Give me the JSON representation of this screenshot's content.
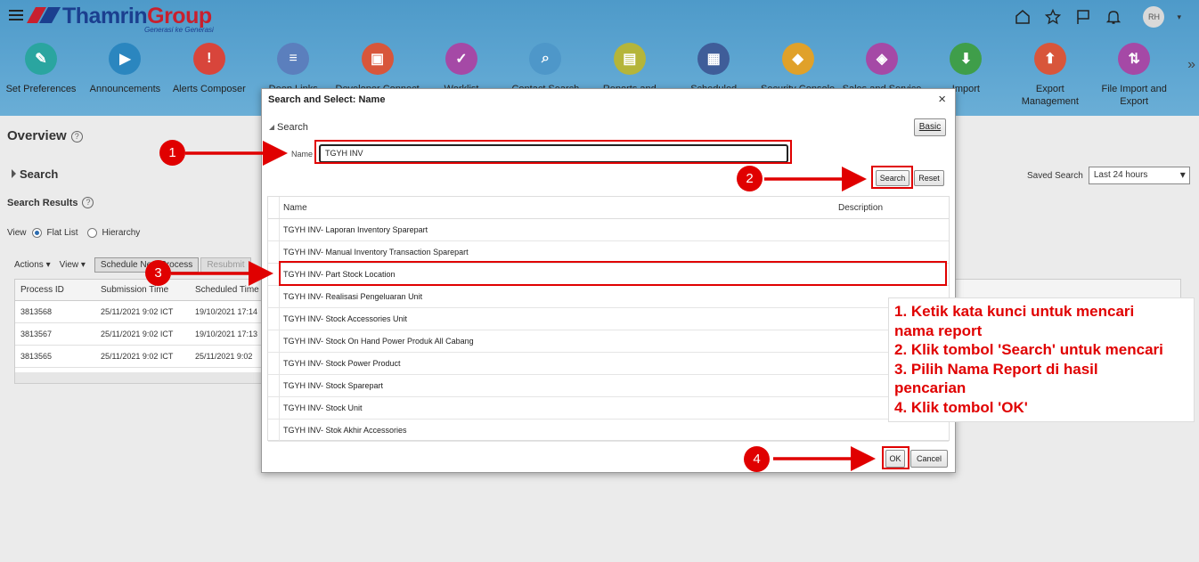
{
  "brand": {
    "name_main": "Thamrin",
    "name_group": "Group",
    "tagline": "Generasi ke Generasi"
  },
  "user": {
    "initials": "RH"
  },
  "springboard": [
    {
      "label": "Set Preferences",
      "icon": "preferences-icon",
      "color": "#2aa5a0"
    },
    {
      "label": "Announcements",
      "icon": "megaphone-icon",
      "color": "#2b86bf"
    },
    {
      "label": "Alerts Composer",
      "icon": "alert-icon",
      "color": "#d8453b"
    },
    {
      "label": "Deep Links",
      "icon": "users-link-icon",
      "color": "#5b7fbd"
    },
    {
      "label": "Developer Connect",
      "icon": "developer-icon",
      "color": "#d8563b"
    },
    {
      "label": "Worklist",
      "icon": "worklist-icon",
      "color": "#a549a6"
    },
    {
      "label": "Contact Search",
      "icon": "contact-search-icon",
      "color": "#4e97c9"
    },
    {
      "label": "Reports and",
      "icon": "reports-icon",
      "color": "#b5b53a"
    },
    {
      "label": "Scheduled",
      "icon": "calendar-icon",
      "color": "#3f5d99"
    },
    {
      "label": "Security Console",
      "icon": "security-icon",
      "color": "#e0a12a"
    },
    {
      "label": "Sales and Service",
      "icon": "shield-icon",
      "color": "#a549a6"
    },
    {
      "label": "Import",
      "icon": "import-icon",
      "color": "#3f9e4a"
    },
    {
      "label": "Export Management",
      "icon": "export-icon",
      "color": "#d8563b"
    },
    {
      "label": "File Import and Export",
      "icon": "file-transfer-icon",
      "color": "#a549a6"
    }
  ],
  "background": {
    "overview": "Overview",
    "search": "Search",
    "search_results": "Search Results",
    "view_label": "View",
    "flat_list": "Flat List",
    "hierarchy": "Hierarchy",
    "actions": "Actions",
    "view_menu": "View",
    "schedule_btn": "Schedule New Process",
    "resubmit_btn": "Resubmit",
    "saved_search_label": "Saved Search",
    "saved_search_value": "Last 24 hours",
    "columns": [
      "Process ID",
      "Submission Time",
      "Scheduled Time"
    ],
    "rows": [
      [
        "3813568",
        "25/11/2021 9:02 ICT",
        "19/10/2021 17:14"
      ],
      [
        "3813567",
        "25/11/2021 9:02 ICT",
        "19/10/2021 17:13"
      ],
      [
        "3813565",
        "25/11/2021 9:02 ICT",
        "25/11/2021 9:02"
      ]
    ]
  },
  "dialog": {
    "title": "Search and Select: Name",
    "search_header": "Search",
    "basic": "Basic",
    "name_label": "Name",
    "name_value": "TGYH INV",
    "search_btn": "Search",
    "reset_btn": "Reset",
    "col_name": "Name",
    "col_desc": "Description",
    "results": [
      "TGYH INV- Laporan Inventory Sparepart",
      "TGYH INV- Manual Inventory Transaction Sparepart",
      "TGYH INV- Part Stock Location",
      "TGYH INV- Realisasi Pengeluaran Unit",
      "TGYH INV- Stock Accessories Unit",
      "TGYH INV- Stock On Hand Power Produk All Cabang",
      "TGYH INV- Stock Power Product",
      "TGYH INV- Stock Sparepart",
      "TGYH INV- Stock Unit",
      "TGYH INV- Stok Akhir Accessories"
    ],
    "ok_btn": "OK",
    "cancel_btn": "Cancel"
  },
  "annotations": {
    "markers": [
      "1",
      "2",
      "3",
      "4"
    ],
    "accent": "#e00000",
    "instructions": [
      "1. Ketik kata kunci untuk mencari",
      "nama report",
      "2. Klik tombol 'Search' untuk mencari",
      "3. Pilih Nama Report di hasil",
      "pencarian",
      "4. Klik tombol 'OK'"
    ]
  }
}
